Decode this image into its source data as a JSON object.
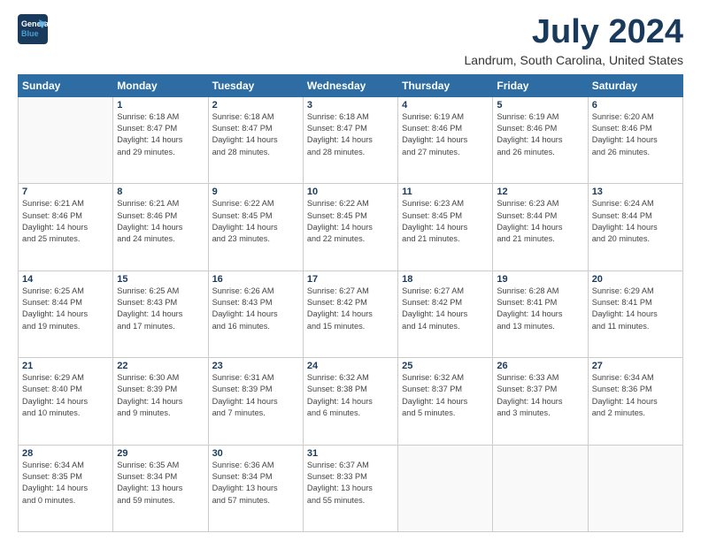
{
  "logo": {
    "line1": "General",
    "line2": "Blue"
  },
  "header": {
    "month": "July 2024",
    "location": "Landrum, South Carolina, United States"
  },
  "weekdays": [
    "Sunday",
    "Monday",
    "Tuesday",
    "Wednesday",
    "Thursday",
    "Friday",
    "Saturday"
  ],
  "weeks": [
    [
      {
        "day": "",
        "detail": ""
      },
      {
        "day": "1",
        "detail": "Sunrise: 6:18 AM\nSunset: 8:47 PM\nDaylight: 14 hours\nand 29 minutes."
      },
      {
        "day": "2",
        "detail": "Sunrise: 6:18 AM\nSunset: 8:47 PM\nDaylight: 14 hours\nand 28 minutes."
      },
      {
        "day": "3",
        "detail": "Sunrise: 6:18 AM\nSunset: 8:47 PM\nDaylight: 14 hours\nand 28 minutes."
      },
      {
        "day": "4",
        "detail": "Sunrise: 6:19 AM\nSunset: 8:46 PM\nDaylight: 14 hours\nand 27 minutes."
      },
      {
        "day": "5",
        "detail": "Sunrise: 6:19 AM\nSunset: 8:46 PM\nDaylight: 14 hours\nand 26 minutes."
      },
      {
        "day": "6",
        "detail": "Sunrise: 6:20 AM\nSunset: 8:46 PM\nDaylight: 14 hours\nand 26 minutes."
      }
    ],
    [
      {
        "day": "7",
        "detail": "Sunrise: 6:21 AM\nSunset: 8:46 PM\nDaylight: 14 hours\nand 25 minutes."
      },
      {
        "day": "8",
        "detail": "Sunrise: 6:21 AM\nSunset: 8:46 PM\nDaylight: 14 hours\nand 24 minutes."
      },
      {
        "day": "9",
        "detail": "Sunrise: 6:22 AM\nSunset: 8:45 PM\nDaylight: 14 hours\nand 23 minutes."
      },
      {
        "day": "10",
        "detail": "Sunrise: 6:22 AM\nSunset: 8:45 PM\nDaylight: 14 hours\nand 22 minutes."
      },
      {
        "day": "11",
        "detail": "Sunrise: 6:23 AM\nSunset: 8:45 PM\nDaylight: 14 hours\nand 21 minutes."
      },
      {
        "day": "12",
        "detail": "Sunrise: 6:23 AM\nSunset: 8:44 PM\nDaylight: 14 hours\nand 21 minutes."
      },
      {
        "day": "13",
        "detail": "Sunrise: 6:24 AM\nSunset: 8:44 PM\nDaylight: 14 hours\nand 20 minutes."
      }
    ],
    [
      {
        "day": "14",
        "detail": "Sunrise: 6:25 AM\nSunset: 8:44 PM\nDaylight: 14 hours\nand 19 minutes."
      },
      {
        "day": "15",
        "detail": "Sunrise: 6:25 AM\nSunset: 8:43 PM\nDaylight: 14 hours\nand 17 minutes."
      },
      {
        "day": "16",
        "detail": "Sunrise: 6:26 AM\nSunset: 8:43 PM\nDaylight: 14 hours\nand 16 minutes."
      },
      {
        "day": "17",
        "detail": "Sunrise: 6:27 AM\nSunset: 8:42 PM\nDaylight: 14 hours\nand 15 minutes."
      },
      {
        "day": "18",
        "detail": "Sunrise: 6:27 AM\nSunset: 8:42 PM\nDaylight: 14 hours\nand 14 minutes."
      },
      {
        "day": "19",
        "detail": "Sunrise: 6:28 AM\nSunset: 8:41 PM\nDaylight: 14 hours\nand 13 minutes."
      },
      {
        "day": "20",
        "detail": "Sunrise: 6:29 AM\nSunset: 8:41 PM\nDaylight: 14 hours\nand 11 minutes."
      }
    ],
    [
      {
        "day": "21",
        "detail": "Sunrise: 6:29 AM\nSunset: 8:40 PM\nDaylight: 14 hours\nand 10 minutes."
      },
      {
        "day": "22",
        "detail": "Sunrise: 6:30 AM\nSunset: 8:39 PM\nDaylight: 14 hours\nand 9 minutes."
      },
      {
        "day": "23",
        "detail": "Sunrise: 6:31 AM\nSunset: 8:39 PM\nDaylight: 14 hours\nand 7 minutes."
      },
      {
        "day": "24",
        "detail": "Sunrise: 6:32 AM\nSunset: 8:38 PM\nDaylight: 14 hours\nand 6 minutes."
      },
      {
        "day": "25",
        "detail": "Sunrise: 6:32 AM\nSunset: 8:37 PM\nDaylight: 14 hours\nand 5 minutes."
      },
      {
        "day": "26",
        "detail": "Sunrise: 6:33 AM\nSunset: 8:37 PM\nDaylight: 14 hours\nand 3 minutes."
      },
      {
        "day": "27",
        "detail": "Sunrise: 6:34 AM\nSunset: 8:36 PM\nDaylight: 14 hours\nand 2 minutes."
      }
    ],
    [
      {
        "day": "28",
        "detail": "Sunrise: 6:34 AM\nSunset: 8:35 PM\nDaylight: 14 hours\nand 0 minutes."
      },
      {
        "day": "29",
        "detail": "Sunrise: 6:35 AM\nSunset: 8:34 PM\nDaylight: 13 hours\nand 59 minutes."
      },
      {
        "day": "30",
        "detail": "Sunrise: 6:36 AM\nSunset: 8:34 PM\nDaylight: 13 hours\nand 57 minutes."
      },
      {
        "day": "31",
        "detail": "Sunrise: 6:37 AM\nSunset: 8:33 PM\nDaylight: 13 hours\nand 55 minutes."
      },
      {
        "day": "",
        "detail": ""
      },
      {
        "day": "",
        "detail": ""
      },
      {
        "day": "",
        "detail": ""
      }
    ]
  ]
}
